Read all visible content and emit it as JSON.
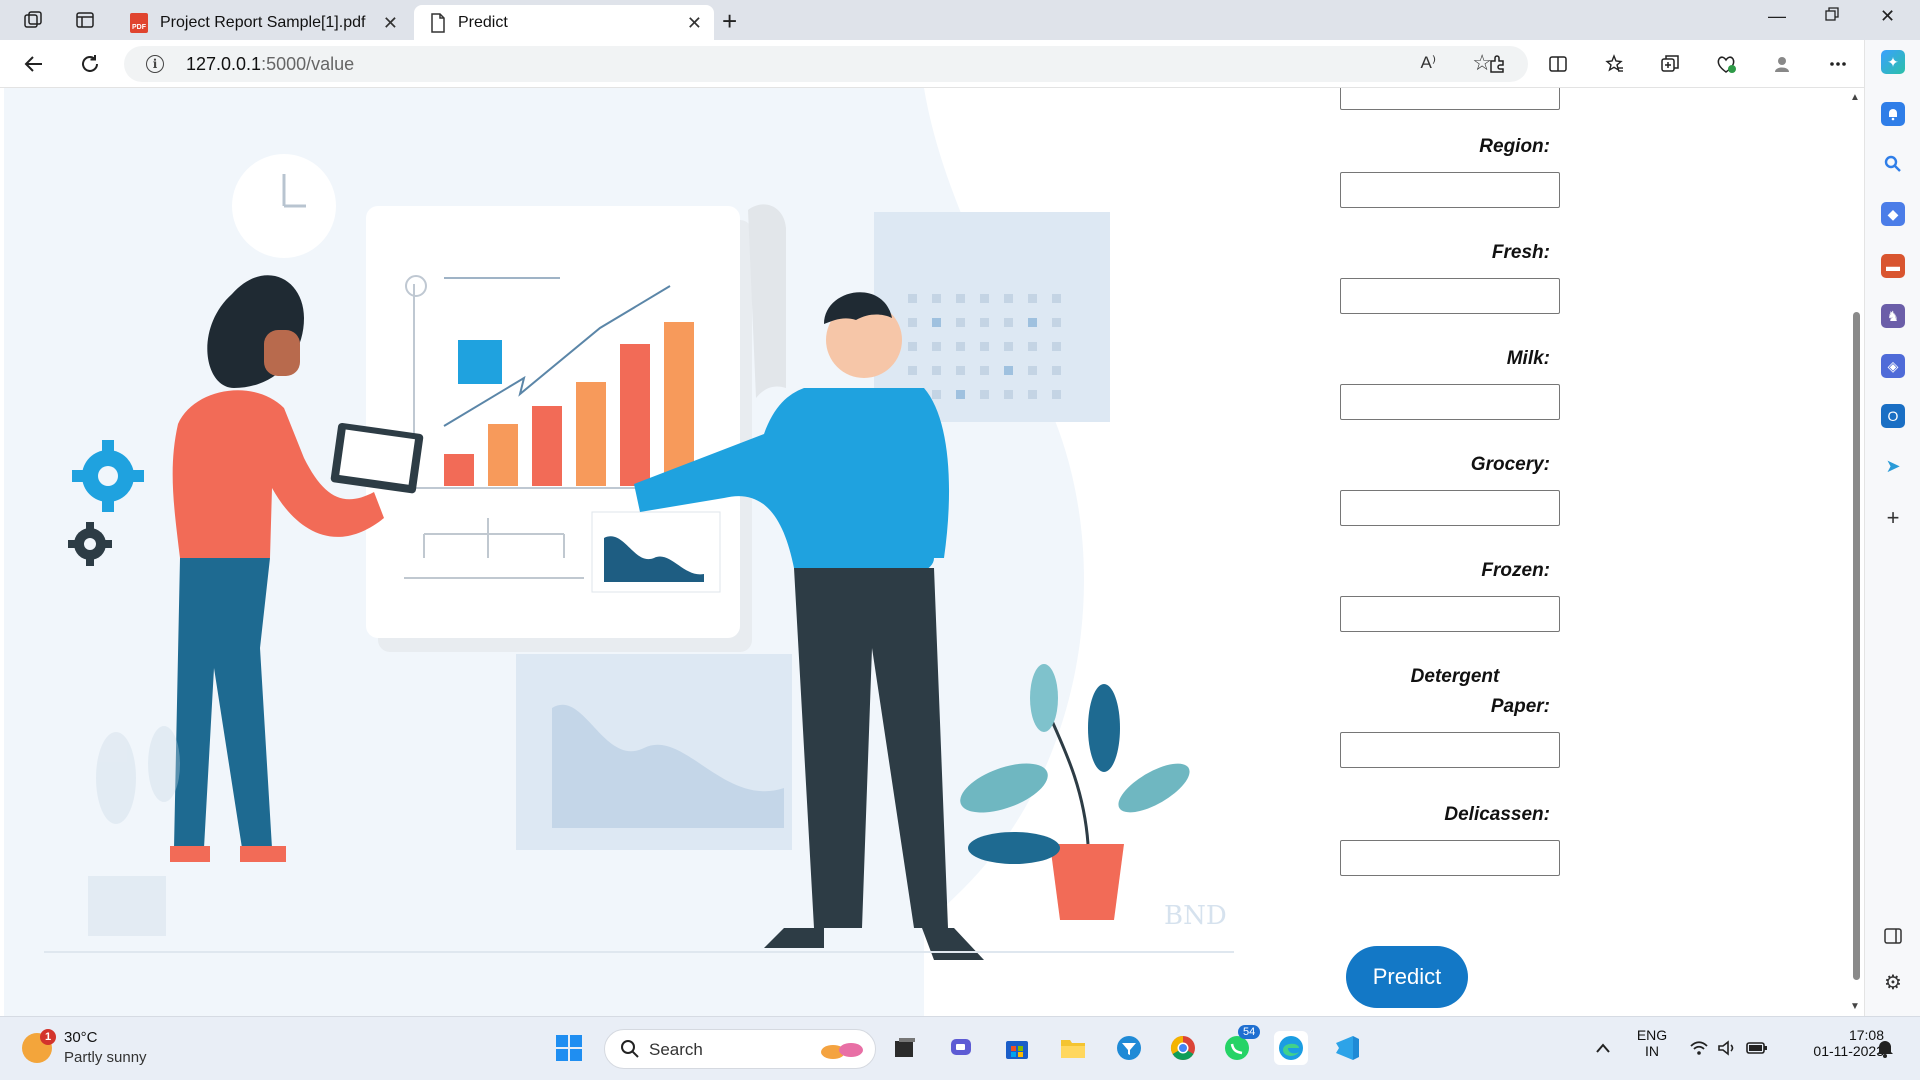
{
  "browser": {
    "tabs": [
      {
        "title": "Project Report Sample[1].pdf",
        "icon": "pdf-icon",
        "icon_label": "PDF",
        "active": false
      },
      {
        "title": "Predict",
        "icon": "page-icon",
        "active": true
      }
    ],
    "url_host": "127.0.0.1",
    "url_path": ":5000/value",
    "read_aloud_label": "A⁾"
  },
  "form": {
    "fields": [
      {
        "label": "Region:",
        "value": ""
      },
      {
        "label": "Fresh:",
        "value": ""
      },
      {
        "label": "Milk:",
        "value": ""
      },
      {
        "label": "Grocery:",
        "value": ""
      },
      {
        "label": "Frozen:",
        "value": ""
      },
      {
        "label_line1": "Detergent",
        "label_line2": "Paper:",
        "value": ""
      },
      {
        "label": "Delicassen:",
        "value": ""
      }
    ],
    "submit_label": "Predict"
  },
  "illustration": {
    "watermark": "BND"
  },
  "taskbar": {
    "weather_temp": "30°C",
    "weather_cond": "Partly sunny",
    "weather_alert": "1",
    "search_placeholder": "Search",
    "whatsapp_badge": "54",
    "lang_line1": "ENG",
    "lang_line2": "IN",
    "time": "17:08",
    "date": "01-11-2023"
  },
  "colors": {
    "accent": "#1378c6",
    "illustration_coral": "#f26b57",
    "illustration_blue": "#1fa2df"
  }
}
